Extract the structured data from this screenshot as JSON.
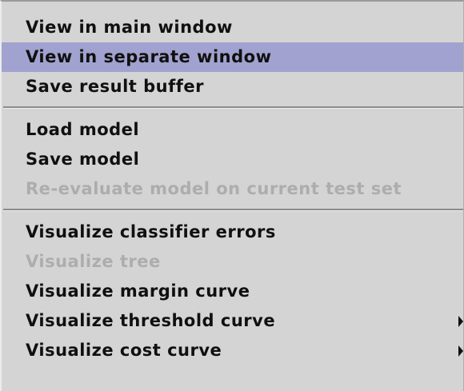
{
  "menu": {
    "group1": [
      {
        "label": "View in main window"
      },
      {
        "label": "View in separate window",
        "highlighted": true
      },
      {
        "label": "Save result buffer"
      }
    ],
    "group2": [
      {
        "label": "Load model"
      },
      {
        "label": "Save model"
      },
      {
        "label": "Re-evaluate model on current test set",
        "disabled": true
      }
    ],
    "group3": [
      {
        "label": "Visualize classifier errors"
      },
      {
        "label": "Visualize tree",
        "disabled": true
      },
      {
        "label": "Visualize margin curve"
      },
      {
        "label": "Visualize threshold curve",
        "submenu": true
      },
      {
        "label": "Visualize cost curve",
        "submenu": true
      }
    ]
  },
  "colors": {
    "background": "#d4d4d4",
    "highlight": "#a1a2cf",
    "text": "#101010",
    "disabled_text": "#adadad"
  }
}
